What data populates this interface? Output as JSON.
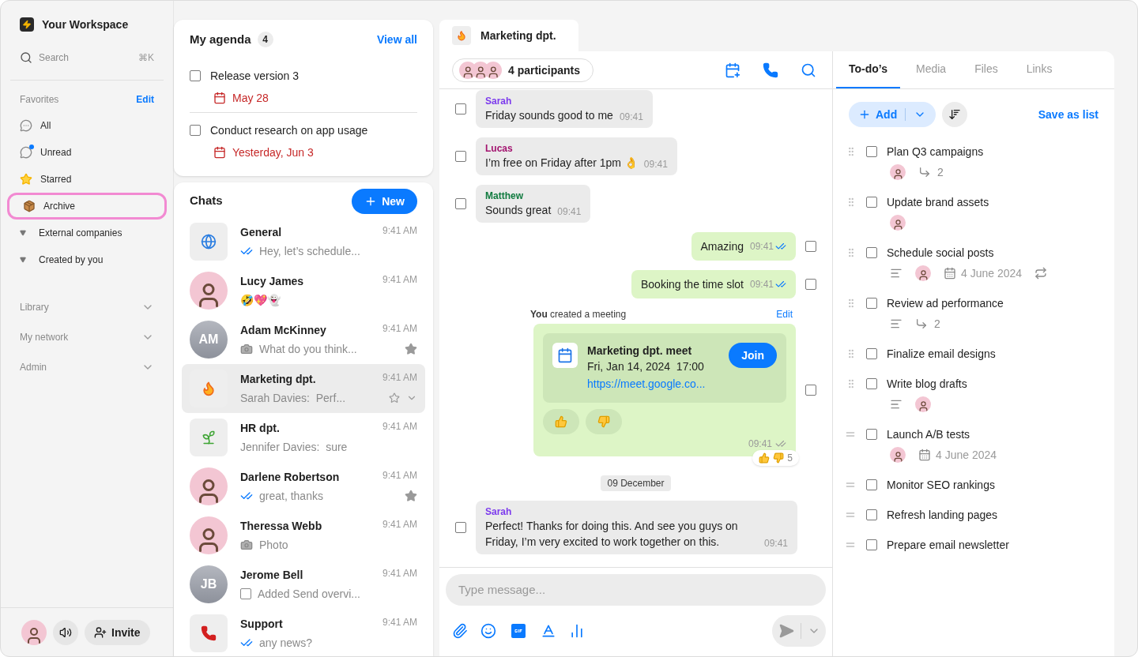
{
  "workspace": {
    "name": "Your Workspace",
    "search": {
      "placeholder": "Search",
      "shortcut": "⌘K"
    }
  },
  "favorites": {
    "title": "Favorites",
    "edit": "Edit",
    "items": [
      {
        "label": "All",
        "kind": "all",
        "highlighted": false
      },
      {
        "label": "Unread",
        "kind": "unread",
        "highlighted": false
      },
      {
        "label": "Starred",
        "kind": "starred",
        "highlighted": false
      },
      {
        "label": "Archive",
        "kind": "archive",
        "highlighted": true
      }
    ],
    "folders": [
      {
        "label": "External companies"
      },
      {
        "label": "Created by you"
      }
    ]
  },
  "sections": [
    {
      "label": "Library"
    },
    {
      "label": "My network"
    },
    {
      "label": "Admin"
    }
  ],
  "footer": {
    "invite": "Invite"
  },
  "agenda": {
    "title": "My agenda",
    "count": "4",
    "view_all": "View all",
    "items": [
      {
        "label": "Release version 3",
        "date": "May 28",
        "checked": false
      },
      {
        "label": "Conduct research on app usage",
        "date": "Yesterday, Jun 3",
        "checked": false
      }
    ]
  },
  "chats": {
    "title": "Chats",
    "new": "New",
    "items": [
      {
        "name": "General",
        "time": "9:41 AM",
        "kind": "globe",
        "preview": {
          "kind": "read",
          "text": "Hey, let’s schedule..."
        },
        "starred": false,
        "selected": false
      },
      {
        "name": "Lucy James",
        "time": "9:41 AM",
        "kind": "photo",
        "preview": {
          "text": "🤣💖👻"
        },
        "starred": false,
        "selected": false
      },
      {
        "name": "Adam McKinney",
        "time": "9:41 AM",
        "kind": "initials",
        "initials": "AM",
        "preview": {
          "kind": "camera",
          "text": "What do you think..."
        },
        "starred": true,
        "selected": false
      },
      {
        "name": "Marketing dpt.",
        "time": "9:41 AM",
        "kind": "flame",
        "preview": {
          "text": "Sarah Davies:  Perf..."
        },
        "starred": false,
        "selected": true
      },
      {
        "name": "HR dpt.",
        "time": "9:41 AM",
        "kind": "sprout",
        "preview": {
          "text": "Jennifer Davies:  sure"
        },
        "starred": false,
        "selected": false
      },
      {
        "name": "Darlene Robertson",
        "time": "9:41 AM",
        "kind": "photo",
        "preview": {
          "kind": "read",
          "text": "great, thanks"
        },
        "starred": true,
        "selected": false
      },
      {
        "name": "Theressa Webb",
        "time": "9:41 AM",
        "kind": "photo",
        "preview": {
          "kind": "camera",
          "text": "Photo"
        },
        "starred": false,
        "selected": false
      },
      {
        "name": "Jerome Bell",
        "time": "9:41 AM",
        "kind": "initials",
        "initials": "JB",
        "preview": {
          "kind": "checkbox",
          "text": "Added Send overvi..."
        },
        "starred": false,
        "selected": false
      },
      {
        "name": "Support",
        "time": "9:41 AM",
        "kind": "phone",
        "preview": {
          "kind": "read",
          "text": "any news?"
        },
        "starred": false,
        "selected": false
      }
    ]
  },
  "conversation": {
    "tab": {
      "title": "Marketing dpt."
    },
    "participants": "4 participants",
    "messages": [
      {
        "kind": "incoming",
        "sender": "Sarah",
        "color": "#7c3aed",
        "text": "Friday sounds good to me",
        "time": "09:41",
        "checked": false
      },
      {
        "kind": "incoming",
        "sender": "Lucas",
        "color": "#a3136f",
        "text": "I’m free on Friday after 1pm 👌",
        "time": "09:41",
        "checked": false
      },
      {
        "kind": "incoming",
        "sender": "Matthew",
        "color": "#0f7a3e",
        "text": "Sounds great",
        "time": "09:41",
        "checked": false
      },
      {
        "kind": "outgoing",
        "text": "Amazing",
        "time": "09:41",
        "read": true,
        "checked": false
      },
      {
        "kind": "outgoing",
        "text": "Booking the time slot",
        "time": "09:41",
        "read": true,
        "checked": false
      },
      {
        "kind": "meeting",
        "caption": "**You** created a meeting",
        "edit": "Edit",
        "title": "Marketing dpt. meet",
        "when": "Fri, Jan 14, 2024  17:00",
        "link": "https://meet.google.co...",
        "join": "Join",
        "time": "09:41",
        "read": false,
        "reaction_count": "5",
        "checked": false
      },
      {
        "kind": "date",
        "text": "09 December"
      },
      {
        "kind": "incoming",
        "sender": "Sarah",
        "color": "#7c3aed",
        "text": "Perfect! Thanks for doing this. And see you guys on Friday, I’m very excited to work together on this.",
        "time": "09:41",
        "checked": false
      }
    ],
    "composer": {
      "placeholder": "Type message..."
    }
  },
  "todos": {
    "tabs": [
      {
        "label": "To-do’s",
        "selected": true
      },
      {
        "label": "Media",
        "selected": false
      },
      {
        "label": "Files",
        "selected": false
      },
      {
        "label": "Links",
        "selected": false
      }
    ],
    "add": "Add",
    "save": "Save as list",
    "items": [
      {
        "label": "Plan Q3 campaigns",
        "checked": false,
        "kind": "dots",
        "meta": [
          {
            "kind": "avatar"
          },
          {
            "kind": "subtasks",
            "text": "2"
          }
        ]
      },
      {
        "label": "Update brand assets",
        "checked": false,
        "kind": "dots",
        "meta": [
          {
            "kind": "avatar"
          }
        ]
      },
      {
        "label": "Schedule social posts",
        "checked": false,
        "kind": "dots",
        "meta": [
          {
            "kind": "notes"
          },
          {
            "kind": "avatar"
          },
          {
            "kind": "date",
            "text": "4 June 2024"
          },
          {
            "kind": "repeat"
          }
        ]
      },
      {
        "label": "Review ad performance",
        "checked": false,
        "kind": "dots",
        "meta": [
          {
            "kind": "notes"
          },
          {
            "kind": "subtasks",
            "text": "2"
          }
        ]
      },
      {
        "label": "Finalize email designs",
        "checked": false,
        "kind": "dots"
      },
      {
        "label": "Write blog drafts",
        "checked": false,
        "kind": "dots",
        "meta": [
          {
            "kind": "notes"
          },
          {
            "kind": "avatar"
          }
        ]
      },
      {
        "label": "Launch A/B tests",
        "checked": false,
        "kind": "lines",
        "meta": [
          {
            "kind": "avatar"
          },
          {
            "kind": "date",
            "text": "4 June 2024"
          }
        ]
      },
      {
        "label": "Monitor SEO rankings",
        "checked": false,
        "kind": "lines"
      },
      {
        "label": "Refresh landing pages",
        "checked": false,
        "kind": "lines"
      },
      {
        "label": "Prepare email newsletter",
        "checked": false,
        "kind": "lines"
      }
    ]
  }
}
